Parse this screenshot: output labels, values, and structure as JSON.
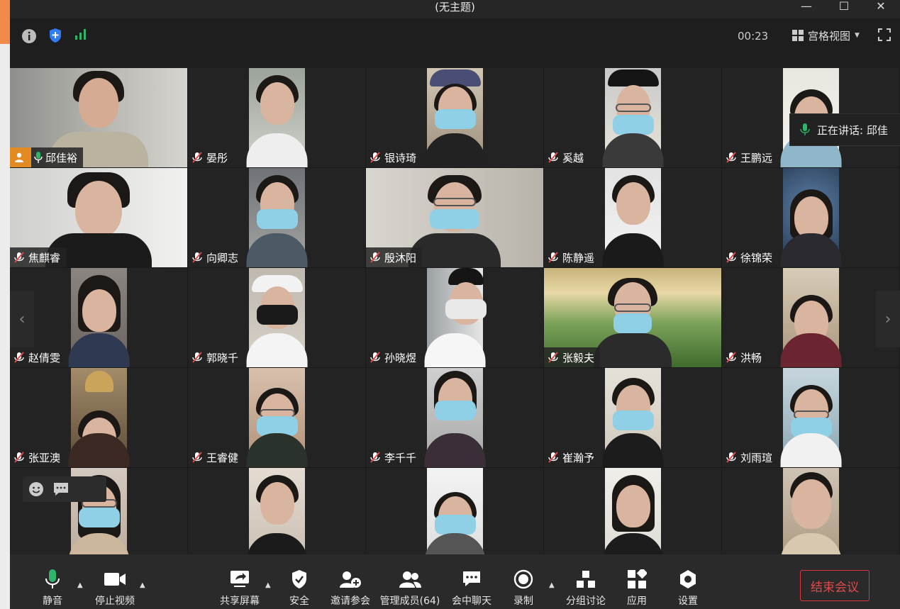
{
  "window": {
    "title": "(无主题)",
    "minimize_glyph": "—",
    "maximize_glyph": "☐",
    "close_glyph": "✕"
  },
  "infobar": {
    "timer": "00:23",
    "view_label": "宫格视图",
    "icons": [
      "info-icon",
      "shield-icon",
      "signal-icon"
    ]
  },
  "speaking": {
    "text": "正在讲话: 邱佳"
  },
  "participants": [
    {
      "name": "邱佳裕",
      "host": true
    },
    {
      "name": "晏彤"
    },
    {
      "name": "银诗琦"
    },
    {
      "name": "奚越"
    },
    {
      "name": "王鹏远"
    },
    {
      "name": "焦麒睿"
    },
    {
      "name": "向卿志"
    },
    {
      "name": "殷沐阳"
    },
    {
      "name": "陈静遥"
    },
    {
      "name": "徐锦荣"
    },
    {
      "name": "赵倩雯"
    },
    {
      "name": "郭晓千"
    },
    {
      "name": "孙晓煜"
    },
    {
      "name": "张毅夫"
    },
    {
      "name": "洪畅"
    },
    {
      "name": "张亚澳"
    },
    {
      "name": "王睿健"
    },
    {
      "name": "李千千"
    },
    {
      "name": "崔瀚予"
    },
    {
      "name": "刘雨瑄"
    }
  ],
  "toolbar": {
    "mute": "静音",
    "stop_video": "停止视频",
    "share_screen": "共享屏幕",
    "security": "安全",
    "invite": "邀请参会",
    "manage": "管理成员(64)",
    "chat": "会中聊天",
    "record": "录制",
    "breakout": "分组讨论",
    "apps": "应用",
    "settings": "设置",
    "end_meeting": "结束会议"
  },
  "colors": {
    "accent_green": "#2fb56a",
    "end_red": "#e04a4a",
    "host_orange": "#e48a22"
  }
}
